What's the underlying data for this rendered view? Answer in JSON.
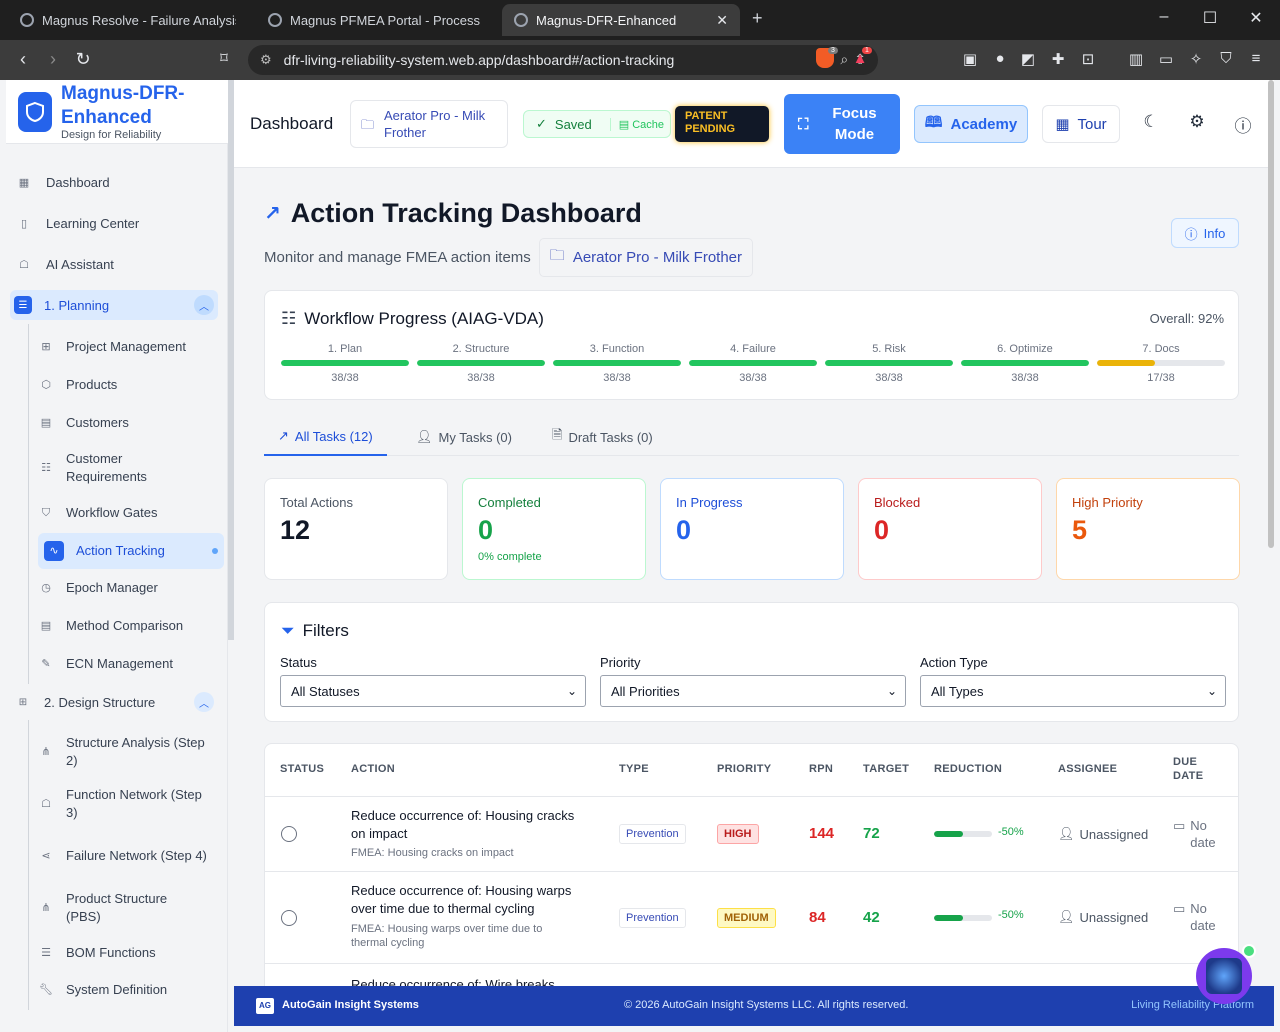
{
  "browser": {
    "tabs": [
      {
        "title": "Magnus Resolve - Failure Analysis"
      },
      {
        "title": "Magnus PFMEA Portal - Process Failu"
      },
      {
        "title": "Magnus-DFR-Enhanced",
        "active": true
      }
    ],
    "url": "dfr-living-reliability-system.web.app/dashboard#/action-tracking",
    "ext_badges": {
      "brave": "3",
      "alert": "1"
    }
  },
  "brand": {
    "name_line1": "Magnus-DFR-",
    "name_line2": "Enhanced",
    "subtitle": "Design for Reliability"
  },
  "sidebar": {
    "top_items": [
      {
        "label": "Dashboard",
        "icon": "grid-icon"
      },
      {
        "label": "Learning Center",
        "icon": "book-icon"
      },
      {
        "label": "AI Assistant",
        "icon": "bot-icon"
      }
    ],
    "planning": {
      "label": "1. Planning",
      "items": [
        {
          "label": "Project Management",
          "icon": "hierarchy-icon"
        },
        {
          "label": "Products",
          "icon": "cube-icon"
        },
        {
          "label": "Customers",
          "icon": "building-icon"
        },
        {
          "label": "Customer Requirements",
          "icon": "checklist-icon"
        },
        {
          "label": "Workflow Gates",
          "icon": "shield-icon"
        },
        {
          "label": "Action Tracking",
          "icon": "activity-icon",
          "active": true
        },
        {
          "label": "Epoch Manager",
          "icon": "timer-icon"
        },
        {
          "label": "Method Comparison",
          "icon": "document-icon"
        },
        {
          "label": "ECN Management",
          "icon": "edit-document-icon"
        }
      ]
    },
    "design": {
      "label": "2. Design Structure",
      "items": [
        {
          "label": "Structure Analysis (Step 2)",
          "icon": "network-icon"
        },
        {
          "label": "Function Network (Step 3)",
          "icon": "bot-icon"
        },
        {
          "label": "Failure Network (Step 4)",
          "icon": "share-icon"
        },
        {
          "label": "Product Structure (PBS)",
          "icon": "network-icon"
        },
        {
          "label": "BOM Functions",
          "icon": "list-icon"
        },
        {
          "label": "System Definition",
          "icon": "wrench-icon"
        }
      ]
    }
  },
  "header": {
    "title": "Dashboard",
    "project": "Aerator Pro - Milk Frother",
    "saved": "Saved",
    "cache": "Cache",
    "patent": "PATENT PENDING",
    "focus": "Focus Mode",
    "academy": "Academy",
    "tour": "Tour"
  },
  "page": {
    "title": "Action Tracking Dashboard",
    "subtitle": "Monitor and manage FMEA action items",
    "project": "Aerator Pro - Milk Frother",
    "info": "Info"
  },
  "workflow": {
    "title": "Workflow Progress (AIAG-VDA)",
    "overall": "Overall: 92%",
    "steps": [
      {
        "label": "1. Plan",
        "count": "38/38",
        "fraction": 1.0,
        "color": "#22c55e"
      },
      {
        "label": "2. Structure",
        "count": "38/38",
        "fraction": 1.0,
        "color": "#22c55e"
      },
      {
        "label": "3. Function",
        "count": "38/38",
        "fraction": 1.0,
        "color": "#22c55e"
      },
      {
        "label": "4. Failure",
        "count": "38/38",
        "fraction": 1.0,
        "color": "#22c55e"
      },
      {
        "label": "5. Risk",
        "count": "38/38",
        "fraction": 1.0,
        "color": "#22c55e"
      },
      {
        "label": "6. Optimize",
        "count": "38/38",
        "fraction": 1.0,
        "color": "#22c55e"
      },
      {
        "label": "7. Docs",
        "count": "17/38",
        "fraction": 0.45,
        "color": "#eab308"
      }
    ]
  },
  "tabs": [
    {
      "label": "All Tasks (12)",
      "icon": "trend-icon",
      "active": true
    },
    {
      "label": "My Tasks (0)",
      "icon": "user-icon"
    },
    {
      "label": "Draft Tasks (0)",
      "icon": "file-icon"
    }
  ],
  "stats": [
    {
      "label": "Total Actions",
      "value": "12",
      "note": "",
      "color": "#111827",
      "label_color": "#4b5563",
      "border": "#e5e7eb"
    },
    {
      "label": "Completed",
      "value": "0",
      "note": "0% complete",
      "color": "#16a34a",
      "label_color": "#15803d",
      "border": "#bbf7d0"
    },
    {
      "label": "In Progress",
      "value": "0",
      "note": "",
      "color": "#2563eb",
      "label_color": "#1d4ed8",
      "border": "#bfdbfe"
    },
    {
      "label": "Blocked",
      "value": "0",
      "note": "",
      "color": "#dc2626",
      "label_color": "#b91c1c",
      "border": "#fecaca"
    },
    {
      "label": "High Priority",
      "value": "5",
      "note": "",
      "color": "#ea580c",
      "label_color": "#c2410c",
      "border": "#fed7aa"
    }
  ],
  "filters": {
    "title": "Filters",
    "status_label": "Status",
    "status_value": "All Statuses",
    "priority_label": "Priority",
    "priority_value": "All Priorities",
    "type_label": "Action Type",
    "type_value": "All Types"
  },
  "table": {
    "headers": {
      "status": "STATUS",
      "action": "ACTION",
      "type": "TYPE",
      "priority": "PRIORITY",
      "rpn": "RPN",
      "target": "TARGET",
      "reduction": "REDUCTION",
      "assignee": "ASSIGNEE",
      "due_line1": "DUE",
      "due_line2": "DATE"
    },
    "rows": [
      {
        "title": "Reduce occurrence of: Housing cracks on impact",
        "sub": "FMEA: Housing cracks on impact",
        "type": "Prevention",
        "priority": "HIGH",
        "rpn": "144",
        "target": "72",
        "reduction": "-50%",
        "reduction_fraction": 0.5,
        "assignee": "Unassigned",
        "due_line1": "No",
        "due_line2": "date"
      },
      {
        "title": "Reduce occurrence of: Housing warps over time due to thermal cycling",
        "sub": "FMEA: Housing warps over time due to thermal cycling",
        "type": "Prevention",
        "priority": "MEDIUM",
        "rpn": "84",
        "target": "42",
        "reduction": "-50%",
        "reduction_fraction": 0.5,
        "assignee": "Unassigned",
        "due_line1": "No",
        "due_line2": "date"
      },
      {
        "title": "Reduce occurrence of: Wire breaks"
      }
    ]
  },
  "footer": {
    "logo": "AG",
    "brand": "AutoGain Insight Systems",
    "copyright": "© 2026 AutoGain Insight Systems LLC. All rights reserved.",
    "right": "Living Reliability Platform"
  }
}
